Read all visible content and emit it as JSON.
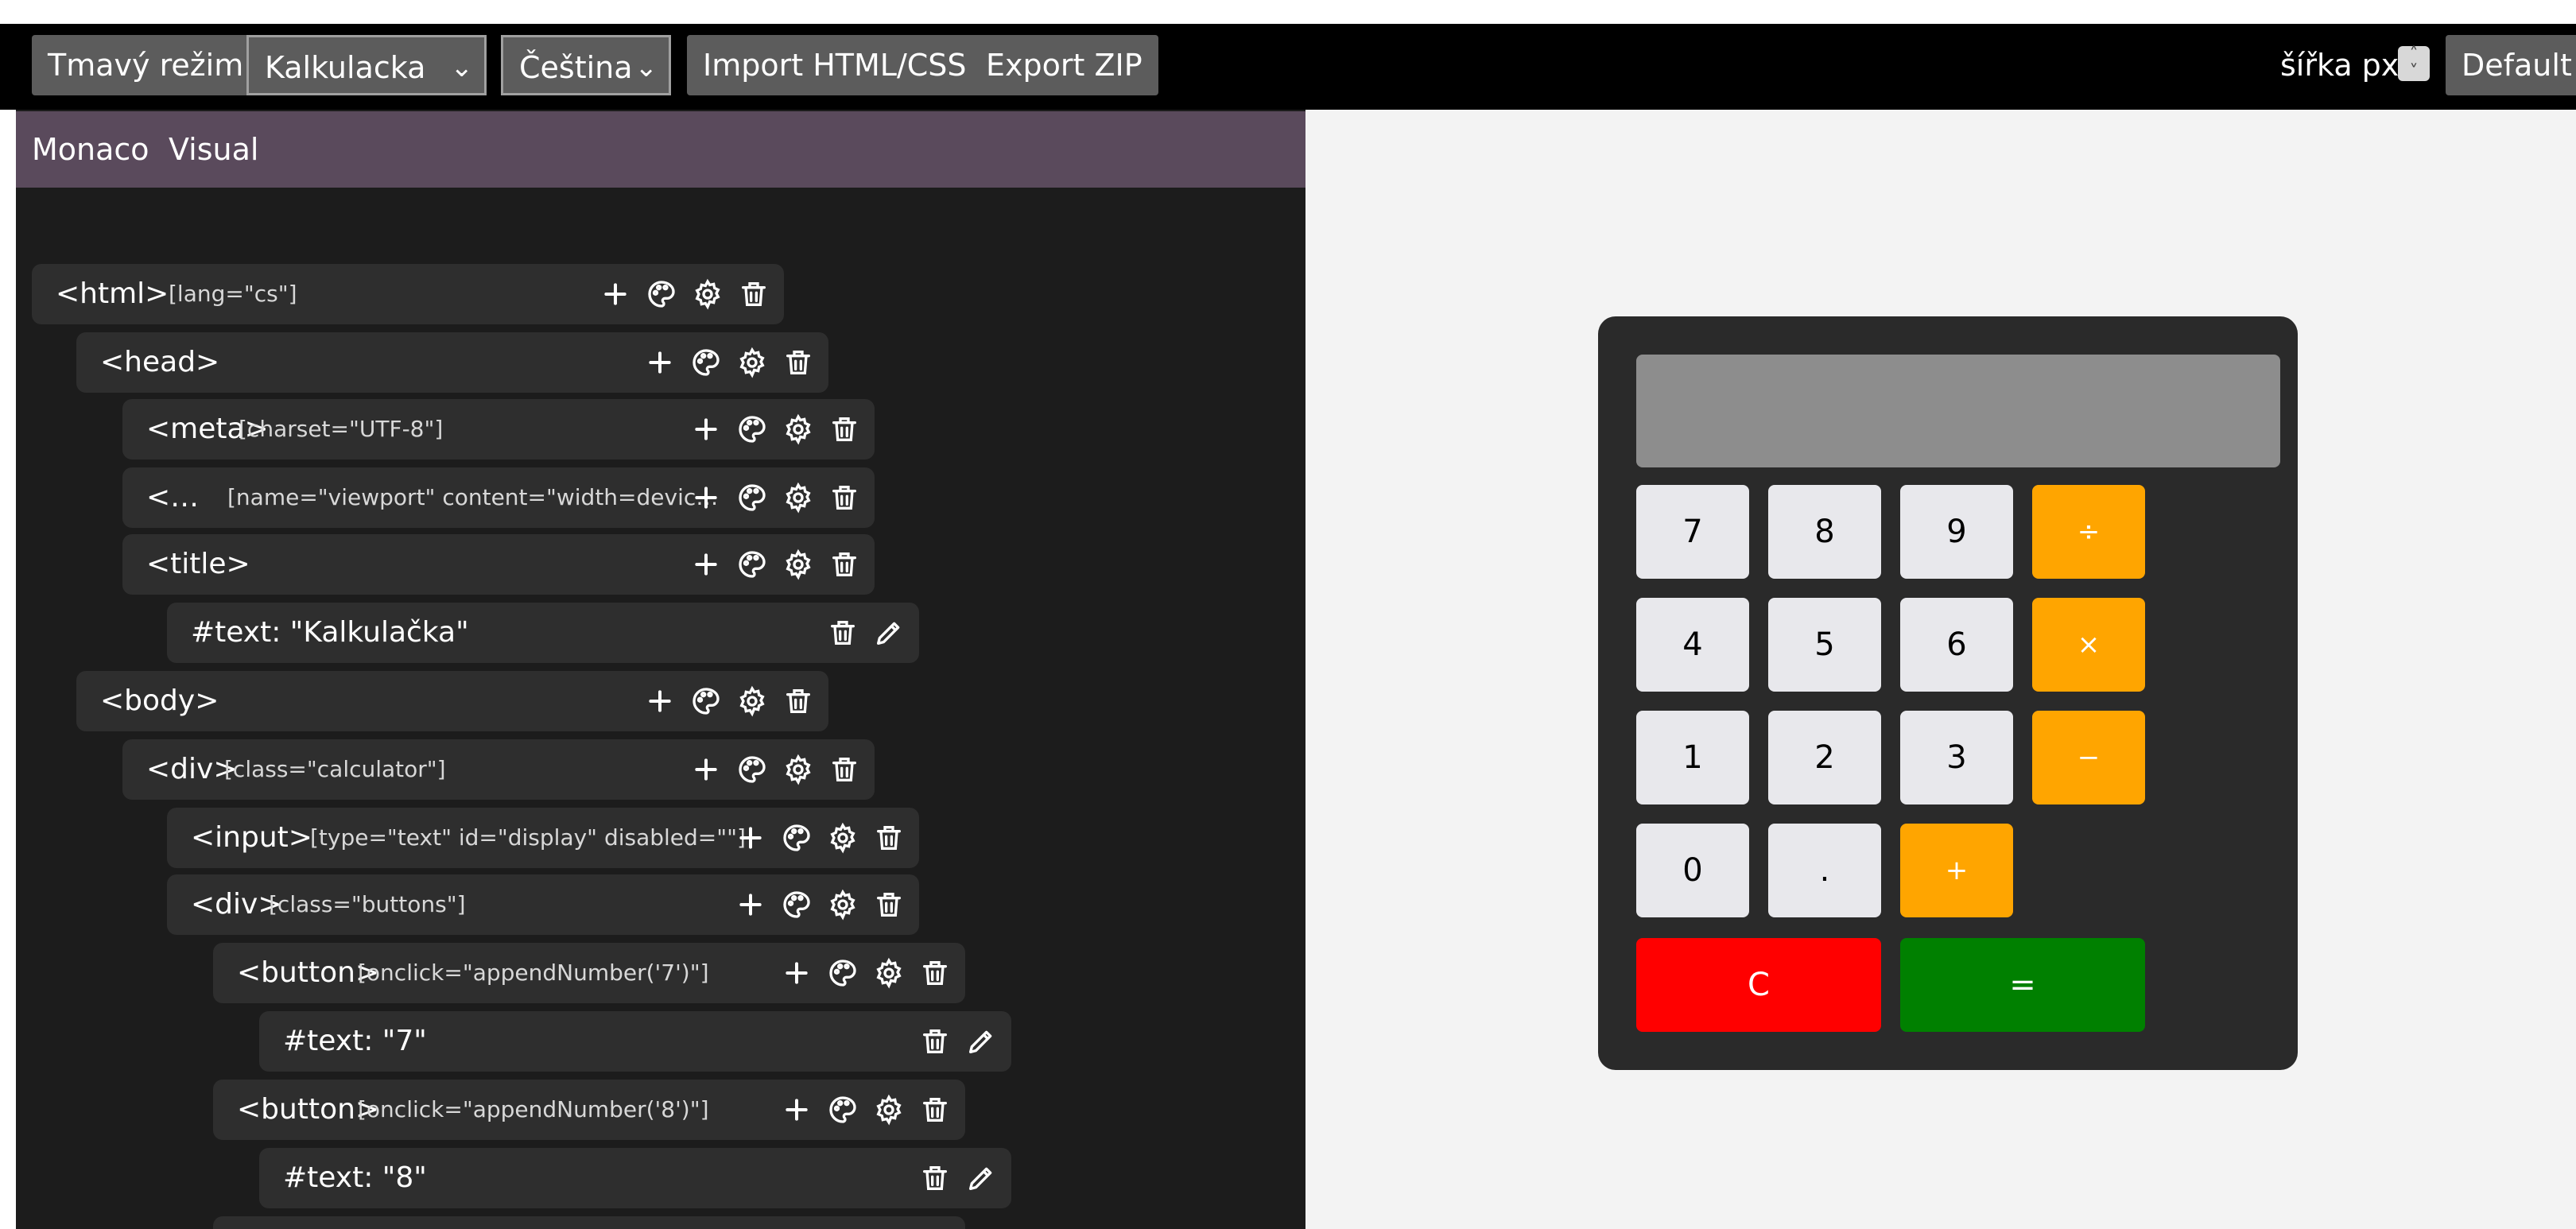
{
  "toolbar": {
    "dark_mode": "Tmavý režim",
    "template_select": "Kalkulacka",
    "language_select": "Čeština",
    "import": "Import HTML/CSS",
    "export": "Export ZIP",
    "width_label": "šířka px",
    "default": "Default"
  },
  "tabs": {
    "monaco": "Monaco",
    "visual": "Visual"
  },
  "tree": [
    {
      "tag": "<html>",
      "attr": "[lang=\"cs\"]"
    },
    {
      "tag": "<head>",
      "attr": ""
    },
    {
      "tag": "<meta>",
      "attr": "[charset=\"UTF-8\"]"
    },
    {
      "tag": "<…",
      "attr": "[name=\"viewport\" content=\"width=devic…"
    },
    {
      "tag": "<title>",
      "attr": ""
    },
    {
      "tag": "#text: \"Kalkulačka\"",
      "attr": ""
    },
    {
      "tag": "<body>",
      "attr": ""
    },
    {
      "tag": "<div>",
      "attr": "[class=\"calculator\"]"
    },
    {
      "tag": "<input>",
      "attr": "[type=\"text\" id=\"display\" disabled=\"\"]"
    },
    {
      "tag": "<div>",
      "attr": "[class=\"buttons\"]"
    },
    {
      "tag": "<button>",
      "attr": "[onclick=\"appendNumber('7')\"]"
    },
    {
      "tag": "#text: \"7\"",
      "attr": ""
    },
    {
      "tag": "<button>",
      "attr": "[onclick=\"appendNumber('8')\"]"
    },
    {
      "tag": "#text: \"8\"",
      "attr": ""
    }
  ],
  "calculator": {
    "display": "",
    "keys": {
      "k7": "7",
      "k8": "8",
      "k9": "9",
      "div": "÷",
      "k4": "4",
      "k5": "5",
      "k6": "6",
      "mul": "×",
      "k1": "1",
      "k2": "2",
      "k3": "3",
      "sub": "−",
      "k0": "0",
      "dot": ".",
      "add": "+",
      "clear": "C",
      "equals": "="
    }
  }
}
